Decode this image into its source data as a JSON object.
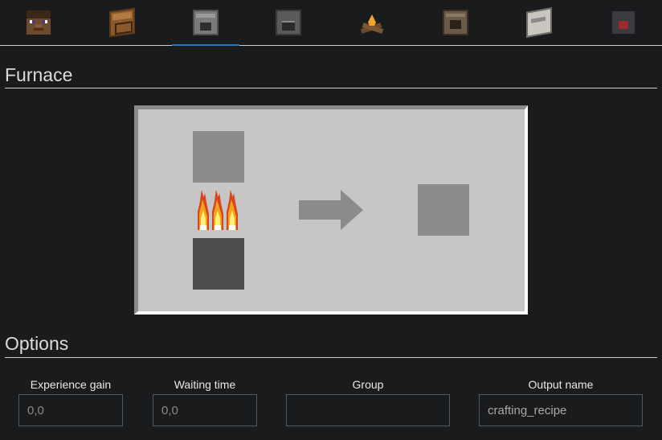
{
  "tabs": [
    {
      "icon": "steve-head-icon"
    },
    {
      "icon": "crafting-table-icon"
    },
    {
      "icon": "furnace-icon",
      "active": true
    },
    {
      "icon": "blast-furnace-icon"
    },
    {
      "icon": "campfire-icon"
    },
    {
      "icon": "smoker-icon"
    },
    {
      "icon": "stonecutter-icon"
    },
    {
      "icon": "smithing-table-icon"
    }
  ],
  "furnace": {
    "title": "Furnace",
    "fuel_icon": "fire-icon",
    "arrow_icon": "progress-arrow-icon"
  },
  "options": {
    "title": "Options",
    "experience": {
      "label": "Experience gain",
      "placeholder": "0,0",
      "value": ""
    },
    "waiting_time": {
      "label": "Waiting time",
      "placeholder": "0,0",
      "value": ""
    },
    "group": {
      "label": "Group",
      "placeholder": "",
      "value": ""
    },
    "output_name": {
      "label": "Output name",
      "placeholder": "",
      "value": "crafting_recipe"
    }
  },
  "colors": {
    "background": "#1a1b1d",
    "accent": "#2a6ec6",
    "gui_panel": "#c6c6c6",
    "slot": "#8b8b8b",
    "fuel_slot": "#4d4d4d"
  }
}
